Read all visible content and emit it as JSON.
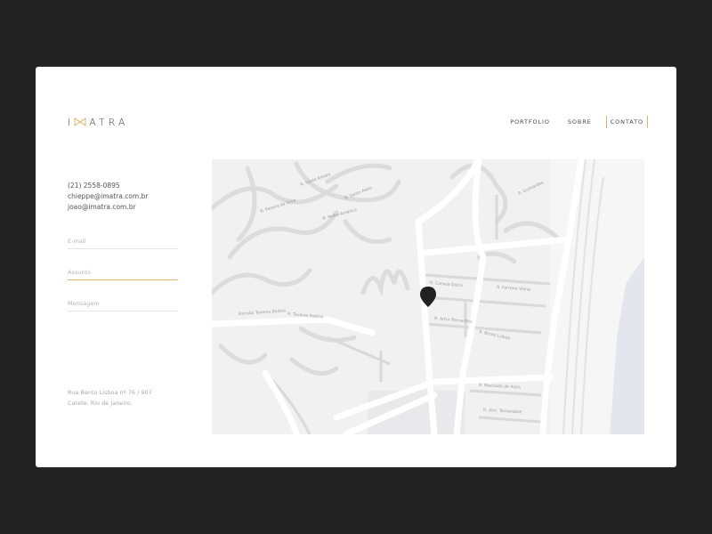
{
  "header": {
    "logo_text": "IMATRA",
    "logo_first": "I",
    "logo_rest": "ATRA",
    "logo_icon": "bowtie-m-icon",
    "accent_color": "#e6b46a",
    "nav": [
      {
        "label": "PORTFOLIO",
        "active": false
      },
      {
        "label": "SOBRE",
        "active": false
      },
      {
        "label": "CONTATO",
        "active": true
      }
    ]
  },
  "contact": {
    "phone": "(21) 2558-0895",
    "emails": [
      "chieppe@imatra.com.br",
      "joao@imatra.com.br"
    ]
  },
  "form": {
    "email_placeholder": "E-mail",
    "subject_placeholder": "Assunto",
    "message_placeholder": "Mensagem"
  },
  "address": {
    "line1": "Rua Bento Lisboa nº 76 / 907",
    "line2": "Catete. Rio de Janeiro."
  },
  "map": {
    "marker_icon": "map-pin-icon",
    "street_labels": [
      "R. Santo Amaro",
      "R. Santo Assis",
      "R. Pereira da Silva",
      "R. Pedro Américo",
      "R. Guimarães",
      "R. Tavares Bastos",
      "R. Correia Dutra",
      "R. Ferreira Viana",
      "R. Artur Bernardes",
      "R. Bento Lisboa",
      "R. Machado de Assis",
      "R. Alm. Tamandaré",
      "Estrada Tavares Bastos"
    ]
  }
}
